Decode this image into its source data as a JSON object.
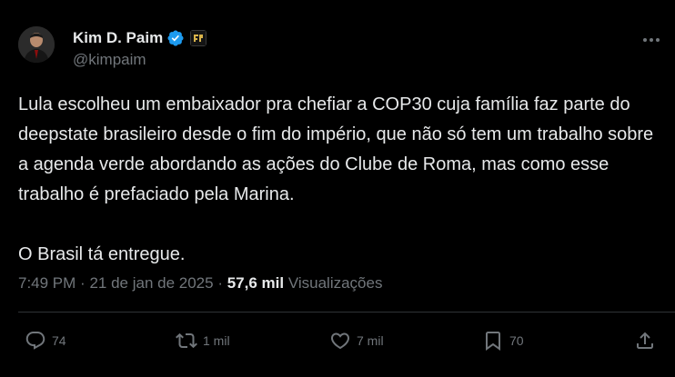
{
  "author": {
    "display_name": "Kim D. Paim",
    "handle": "@kimpaim",
    "verified": true
  },
  "tweet": {
    "paragraphs": [
      "Lula escolheu um embaixador pra chefiar a COP30 cuja família faz parte do deepstate brasileiro desde o fim do império, que não só tem um trabalho sobre a agenda verde abordando as ações do Clube de Roma, mas como esse trabalho é prefaciado pela Marina.",
      "O Brasil tá entregue."
    ],
    "time": "7:49 PM",
    "separator": "·",
    "date": "21 de jan de 2025",
    "views_count": "57,6 mil",
    "views_label": "Visualizações"
  },
  "actions": {
    "replies": "74",
    "retweets": "1 mil",
    "likes": "7 mil",
    "bookmarks": "70"
  },
  "icons": [
    "verified-badge-icon",
    "affiliate-badge-icon",
    "more-icon",
    "reply-icon",
    "retweet-icon",
    "like-icon",
    "bookmark-icon",
    "share-icon"
  ],
  "colors": {
    "background": "#000000",
    "text": "#e7e9ea",
    "muted": "#71767b",
    "verified": "#1d9bf0"
  }
}
